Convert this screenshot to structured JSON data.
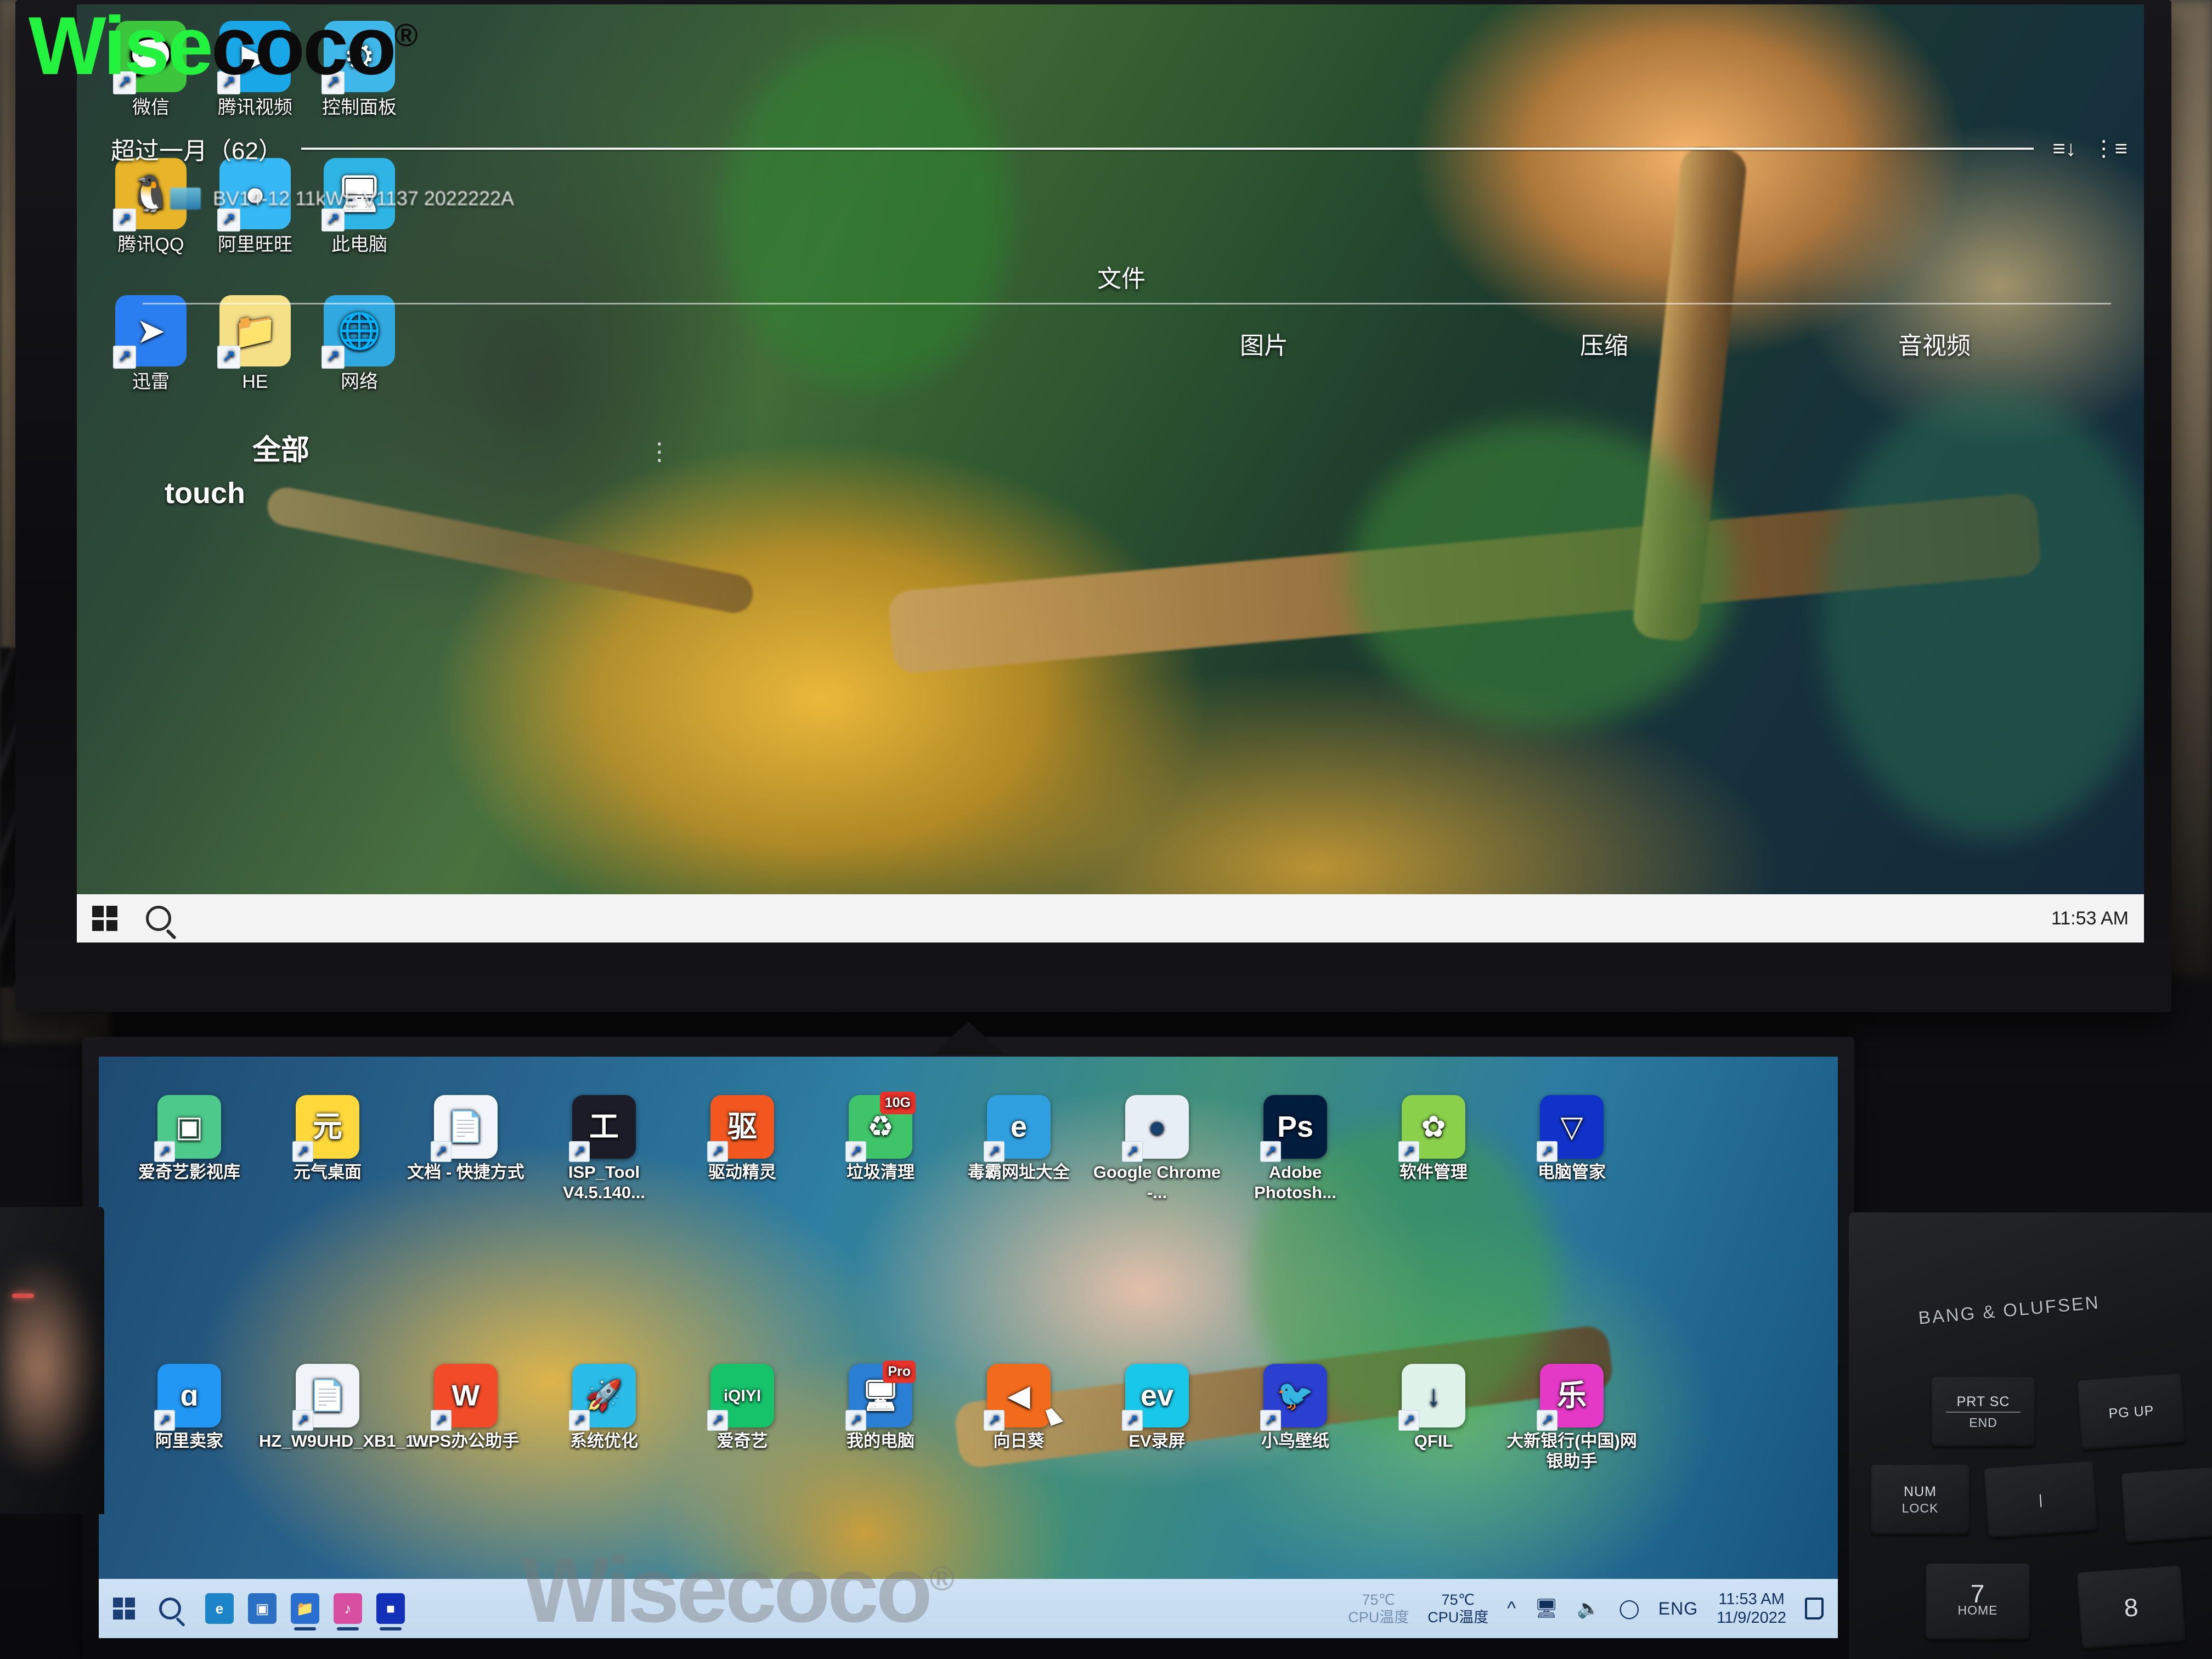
{
  "brand": {
    "watermark_green": "Wise",
    "watermark_dark": "coco",
    "registered_mark": "®",
    "ghost_watermark": "Wisecoco",
    "ghost_registered": "®"
  },
  "top_screen": {
    "desktop_icons": [
      {
        "label": "微信",
        "icon": "wechat-icon",
        "glyph": "💬",
        "color": "#3ec53e",
        "row": 0,
        "col": 0
      },
      {
        "label": "腾讯视频",
        "icon": "tencent-video-icon",
        "glyph": "▶",
        "color": "#1aa7e8",
        "row": 0,
        "col": 1
      },
      {
        "label": "控制面板",
        "icon": "control-panel-icon",
        "glyph": "⚙",
        "color": "#3fb7e8",
        "row": 0,
        "col": 2
      },
      {
        "label": "腾讯QQ",
        "icon": "qq-icon",
        "glyph": "🐧",
        "color": "#e8b52a",
        "row": 1,
        "col": 0
      },
      {
        "label": "阿里旺旺",
        "icon": "aliwangwang-icon",
        "glyph": "●",
        "color": "#36b8f5",
        "row": 1,
        "col": 1
      },
      {
        "label": "此电脑",
        "icon": "this-pc-icon",
        "glyph": "🖥",
        "color": "#2fb5e5",
        "row": 1,
        "col": 2
      },
      {
        "label": "迅雷",
        "icon": "thunder-xunlei-icon",
        "glyph": "➤",
        "color": "#2b7ef0",
        "row": 2,
        "col": 0
      },
      {
        "label": "HE",
        "icon": "folder-user-icon",
        "glyph": "📁",
        "color": "#f5df87",
        "row": 2,
        "col": 1
      },
      {
        "label": "网络",
        "icon": "network-icon",
        "glyph": "🌐",
        "color": "#31a9e0",
        "row": 2,
        "col": 2
      }
    ],
    "overlay": {
      "group_title": "超过一月（62）",
      "sort_icon": "sort-descending-icon",
      "view_icon": "list-view-icon",
      "blurred_file_row": "BV14-12  11kWE  V1137 2022222A",
      "tabs": [
        {
          "label": "文件",
          "icon": "files-tab"
        },
        {
          "label": "图片",
          "icon": "images-tab"
        },
        {
          "label": "压缩",
          "icon": "archive-tab"
        },
        {
          "label": "音视频",
          "icon": "media-tab"
        }
      ],
      "floating_labels": [
        {
          "text": "全部",
          "icon": "all-label"
        },
        {
          "text": "touch",
          "icon": "touch-label"
        }
      ]
    },
    "taskbar": {
      "start_icon": "windows-start-icon",
      "search_icon": "search-icon",
      "clock": "11:53 AM"
    }
  },
  "bottom_screen": {
    "desktop_icons_row1": [
      {
        "label": "爱奇艺影视库",
        "icon": "iqiyi-video-library-icon",
        "glyph": "▣",
        "color": "#4cc98b"
      },
      {
        "label": "元气桌面",
        "icon": "yuanqi-desktop-icon",
        "glyph": "元",
        "color": "#ffd93b"
      },
      {
        "label": "文档 - 快捷方式",
        "icon": "documents-shortcut-icon",
        "glyph": "📄",
        "color": "#f2f6fb"
      },
      {
        "label": "ISP_Tool V4.5.140...",
        "icon": "isp-tool-icon",
        "glyph": "工",
        "color": "#1c1c28"
      },
      {
        "label": "驱动精灵",
        "icon": "driver-genius-icon",
        "glyph": "驱",
        "color": "#f2571f"
      },
      {
        "label": "垃圾清理",
        "icon": "junk-cleaner-icon",
        "glyph": "♻",
        "color": "#3fc46a",
        "badge": "10G"
      },
      {
        "label": "毒霸网址大全",
        "icon": "duba-websites-icon",
        "glyph": "e",
        "color": "#2f9fe0"
      },
      {
        "label": "Google Chrome -...",
        "icon": "google-chrome-icon",
        "glyph": "●",
        "color": "#e8eef6"
      },
      {
        "label": "Adobe Photosh...",
        "icon": "adobe-photoshop-icon",
        "glyph": "Ps",
        "color": "#021c3d"
      },
      {
        "label": "软件管理",
        "icon": "software-manager-icon",
        "glyph": "✿",
        "color": "#8ad04a"
      },
      {
        "label": "电脑管家",
        "icon": "pc-manager-icon",
        "glyph": "▽",
        "color": "#1032c8"
      }
    ],
    "desktop_icons_row2": [
      {
        "label": "阿里卖家",
        "icon": "ali-seller-icon",
        "glyph": "ɑ",
        "color": "#2196f3"
      },
      {
        "label": "HZ_W9UHD_XB1_1...",
        "icon": "file-hz-icon",
        "glyph": "📄",
        "color": "#f0f4f9"
      },
      {
        "label": "WPS办公助手",
        "icon": "wps-office-assistant-icon",
        "glyph": "W",
        "color": "#f24b2a"
      },
      {
        "label": "系统优化",
        "icon": "system-optimize-icon",
        "glyph": "🚀",
        "color": "#2bbbe8"
      },
      {
        "label": "爱奇艺",
        "icon": "iqiyi-icon",
        "glyph": "iQIYI",
        "color": "#16c36b"
      },
      {
        "label": "我的电脑",
        "icon": "my-computer-icon",
        "glyph": "🖥",
        "color": "#2a7fd4",
        "badge": "Pro"
      },
      {
        "label": "向日葵",
        "icon": "sunflower-remote-icon",
        "glyph": "◀",
        "color": "#f26a1b"
      },
      {
        "label": "EV录屏",
        "icon": "ev-recorder-icon",
        "glyph": "ev",
        "color": "#19c7e8"
      },
      {
        "label": "小鸟壁纸",
        "icon": "bird-wallpaper-icon",
        "glyph": "🐦",
        "color": "#2b3fd0"
      },
      {
        "label": "QFIL",
        "icon": "qfil-icon",
        "glyph": "↓",
        "color": "#dff3ea"
      },
      {
        "label": "大新银行(中国)网银助手",
        "icon": "dah-sing-bank-icon",
        "glyph": "乐",
        "color": "#e339c6"
      }
    ],
    "taskbar": {
      "start_icon": "windows-start-icon",
      "search_icon": "search-icon",
      "pinned": [
        {
          "icon": "taskbar-app-ie",
          "glyph": "e",
          "color": "#1d84c8",
          "running": false
        },
        {
          "icon": "taskbar-app-store",
          "glyph": "▣",
          "color": "#2b6fc2",
          "running": false
        },
        {
          "icon": "taskbar-app-explorer",
          "glyph": "📁",
          "color": "#2a6fd0",
          "running": true
        },
        {
          "icon": "taskbar-app-media",
          "glyph": "♪",
          "color": "#d84ea0",
          "running": true
        },
        {
          "icon": "taskbar-app-blue",
          "glyph": "■",
          "color": "#1230b8",
          "running": true
        }
      ],
      "tray": {
        "cpu_widget_label": "CPU温度",
        "cpu_widget_value": "75℃",
        "cpu_temp_value": "75℃",
        "cpu_temp_label": "CPU温度",
        "chevron_icon": "chevron-up-icon",
        "network_icon": "network-tray-icon",
        "volume_icon": "volume-icon",
        "wifi_icon": "wifi-icon",
        "language": "ENG",
        "clock_time": "11:53 AM",
        "clock_date": "11/9/2022",
        "notification_icon": "action-center-icon"
      }
    }
  },
  "laptop": {
    "brand_label": "BANG & OLUFSEN",
    "keys": [
      {
        "top": "PRT SC",
        "bottom": "END",
        "name": "key-prtsc-end"
      },
      {
        "top": "PG UP",
        "bottom": "",
        "name": "key-pgup"
      },
      {
        "top": "NUM",
        "bottom": "LOCK",
        "name": "key-numlock"
      },
      {
        "top": "|",
        "bottom": "",
        "name": "key-pipe"
      },
      {
        "top": "7",
        "bottom": "HOME",
        "name": "key-7-home"
      },
      {
        "top": "8",
        "bottom": "",
        "name": "key-8"
      }
    ]
  }
}
